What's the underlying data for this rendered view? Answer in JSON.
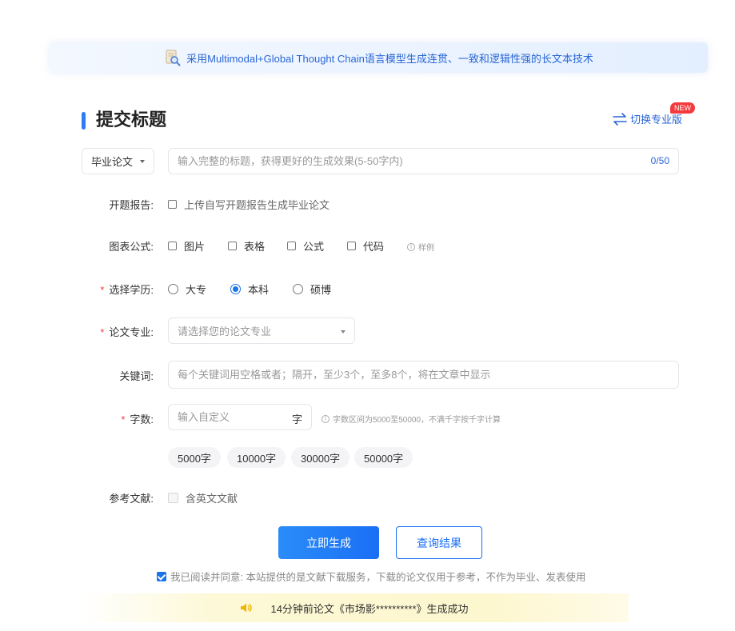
{
  "banner": {
    "text": "采用Multimodal+Global Thought Chain语言模型生成连贯、一致和逻辑性强的长文本技术",
    "icon": "document-search-icon"
  },
  "header": {
    "title": "提交标题",
    "switch_label": "切换专业版",
    "new_badge": "NEW"
  },
  "paper_type": {
    "selected": "毕业论文"
  },
  "title_input": {
    "placeholder": "输入完整的标题，获得更好的生成效果(5-50字内)",
    "value": "",
    "counter": "0/50"
  },
  "proposal": {
    "label": "开题报告:",
    "option": "上传自写开题报告生成毕业论文"
  },
  "charts": {
    "label": "图表公式:",
    "options": [
      "图片",
      "表格",
      "公式",
      "代码"
    ],
    "hint": "样例"
  },
  "education": {
    "label": "选择学历:",
    "options": [
      "大专",
      "本科",
      "硕博"
    ],
    "selected": "本科"
  },
  "major": {
    "label": "论文专业:",
    "placeholder": "请选择您的论文专业"
  },
  "keywords": {
    "label": "关键词:",
    "placeholder": "每个关键词用空格或者；隔开，至少3个，至多8个，将在文章中显示"
  },
  "word_count": {
    "label": "字数:",
    "placeholder": "输入自定义",
    "unit": "字",
    "hint": "字数区间为5000至50000，不满千字按千字计算",
    "presets": [
      "5000字",
      "10000字",
      "30000字",
      "50000字"
    ]
  },
  "references": {
    "label": "参考文献:",
    "option": "含英文文献"
  },
  "actions": {
    "generate": "立即生成",
    "query": "查询结果"
  },
  "agreement": {
    "text": "我已阅读并同意: 本站提供的是文献下载服务，下载的论文仅用于参考，不作为毕业、发表使用",
    "checked": true
  },
  "notice": {
    "text": "14分钟前论文《市场影**********》生成成功"
  },
  "colors": {
    "accent": "#1a73e8",
    "badge": "#f5393c",
    "required": "#f23c3c"
  }
}
